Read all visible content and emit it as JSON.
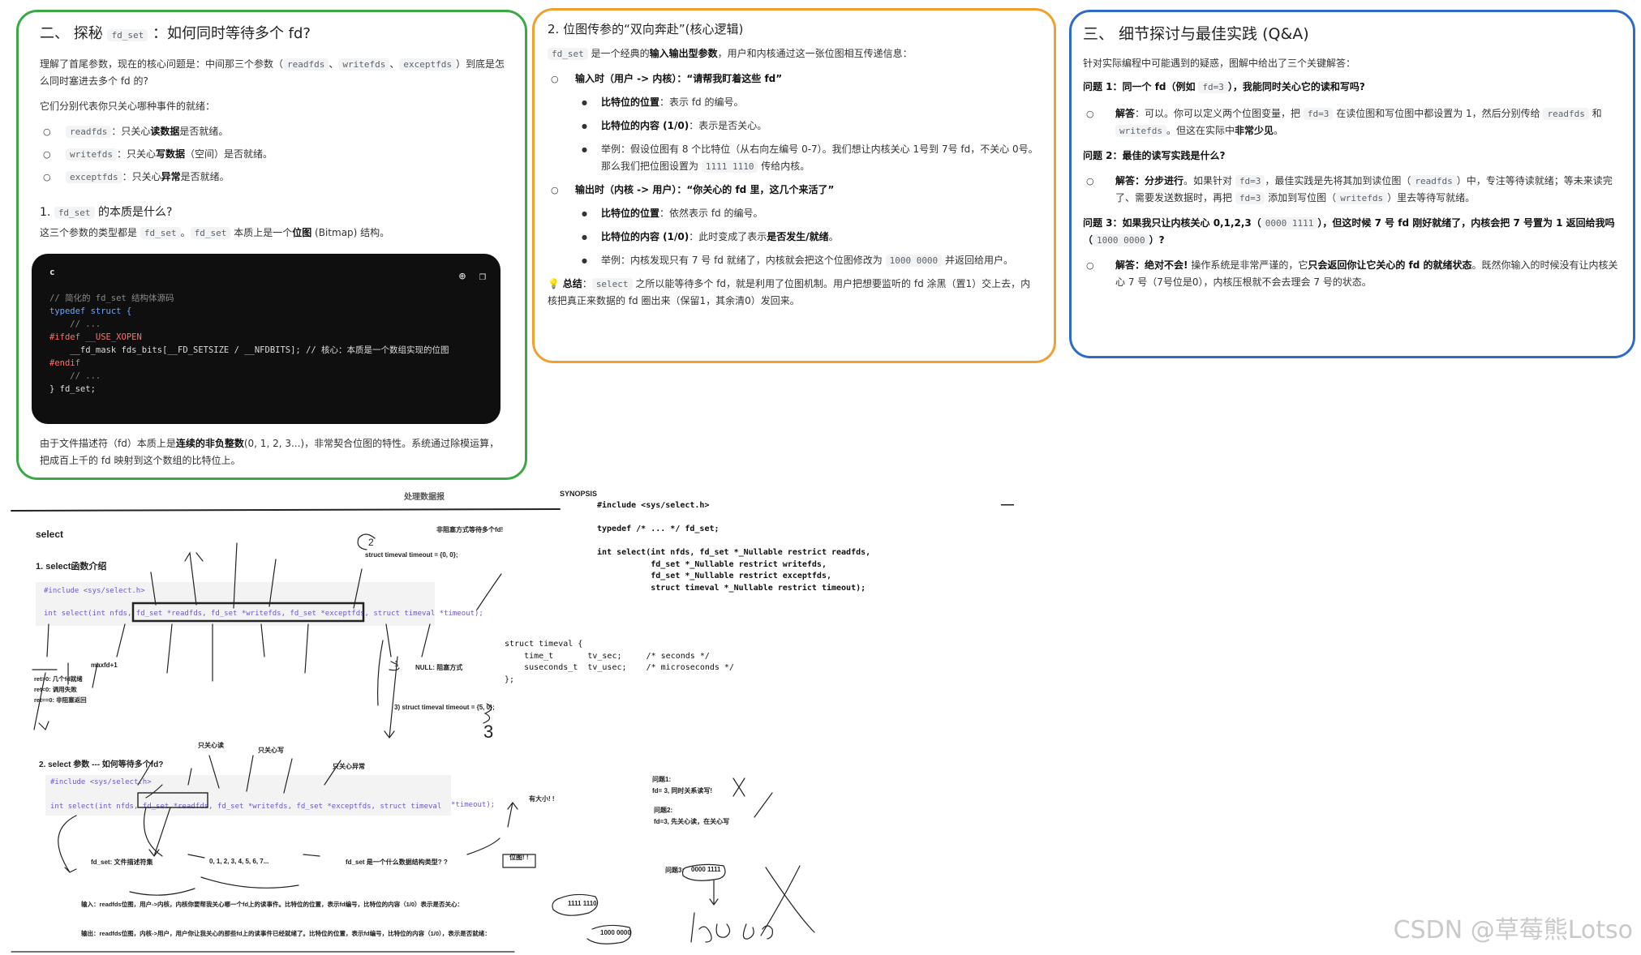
{
  "green": {
    "title_pre": "二、 探秘",
    "title_code": "fd_set",
    "title_post": "：如何同时等待多个 fd?",
    "intro_1": "理解了首尾参数，现在的核心问题是：中间那三个参数（",
    "intro_c1": "readfds",
    "intro_c2": "writefds",
    "intro_c3": "exceptfds",
    "intro_2": "）到底是怎么同时塞进去多个 fd 的?",
    "intro_3": "它们分别代表你只关心哪种事件的就绪：",
    "items": [
      {
        "code": "readfds",
        "pre": "：只关心",
        "bold": "读数据",
        "post": "是否就绪。"
      },
      {
        "code": "writefds",
        "pre": "：只关心",
        "bold": "写数据",
        "post": "（空间）是否就绪。"
      },
      {
        "code": "exceptfds",
        "pre": "：只关心",
        "bold": "异常",
        "post": "是否就绪。"
      }
    ],
    "sub_pre": "1.",
    "sub_code": "fd_set",
    "sub_post": "的本质是什么?",
    "sub_text_1": "这三个参数的类型都是",
    "sub_text_c1": "fd_set",
    "sub_text_c2": "fd_set",
    "sub_text_2": "本质上是一个",
    "sub_text_bold": "位图",
    "sub_text_3": "(Bitmap) 结构。",
    "code_lang": "c",
    "code_lines": [
      "// 简化的 fd_set 结构体源码",
      "typedef struct {",
      "    // ...",
      "#ifdef __USE_XOPEN",
      "    __fd_mask fds_bits[__FD_SETSIZE / __NFDBITS]; // 核心：本质是一个数组实现的位图",
      "#endif",
      "    // ...",
      "} fd_set;"
    ],
    "outro_1": "由于文件描述符（fd）本质上是",
    "outro_bold": "连续的非负整数",
    "outro_2": "(0, 1, 2, 3...)，非常契合位图的特性。系统通过除模运算，把成百上千的 fd 映射到这个数组的比特位上。"
  },
  "orange": {
    "title": "2. 位图传参的“双向奔赴”(核心逻辑)",
    "intro_code": "fd_set",
    "intro_1": "是一个经典的",
    "intro_bold": "输入输出型参数",
    "intro_2": "，用户和内核通过这一张位图相互传递信息：",
    "in_title": "输入时（用户 -> 内核）：“请帮我盯着这些 fd”",
    "in_pos_bold": "比特位的位置",
    "in_pos": "：表示 fd 的编号。",
    "in_val_bold": "比特位的内容 (1/0)",
    "in_val": "：表示是否关心。",
    "in_ex_1": "举例：假设位图有 8 个比特位（从右向左编号 0-7）。我们想让内核关心 1号到 7号 fd，不关心 0号。那么我们把位图设置为",
    "in_ex_code": "1111 1110",
    "in_ex_2": "传给内核。",
    "out_title": "输出时（内核 -> 用户）：“你关心的 fd 里，这几个来活了”",
    "out_pos_bold": "比特位的位置",
    "out_pos": "：依然表示 fd 的编号。",
    "out_val_bold": "比特位的内容 (1/0)",
    "out_val": "：此时变成了表示",
    "out_val_bold2": "是否发生/就绪",
    "out_val_end": "。",
    "out_ex_1": "举例：内核发现只有 7 号 fd 就绪了，内核就会把这个位图修改为",
    "out_ex_code": "1000 0000",
    "out_ex_2": "并返回给用户。",
    "sum_icon": "💡",
    "sum_bold": "总结",
    "sum_code": "select",
    "sum_text": "之所以能等待多个 fd，就是利用了位图机制。用户把想要监听的 fd 涂黑（置1）交上去，内核把真正来数据的 fd 圈出来（保留1，其余清0）发回来。"
  },
  "blue": {
    "title": "三、 细节探讨与最佳实践 (Q&A)",
    "intro": "针对实际编程中可能遇到的疑惑，图解中给出了三个关键解答：",
    "q1_a": "问题 1：同一个 fd（例如",
    "q1_code": "fd=3",
    "q1_b": "），我能同时关心它的读和写吗?",
    "a1_bold": "解答",
    "a1_1": "：可以。你可以定义两个位图变量，把",
    "a1_code": "fd=3",
    "a1_2": "在读位图和写位图中都设置为 1，然后分别传给",
    "a1_c2": "readfds",
    "a1_3": "和",
    "a1_c3": "writefds",
    "a1_4": "。但这在实际中",
    "a1_bold2": "非常少见",
    "a1_5": "。",
    "q2": "问题 2：最佳的读写实践是什么?",
    "a2_bold": "解答：分步进行",
    "a2_1": "。如果针对",
    "a2_code": "fd=3",
    "a2_2": "，最佳实践是先将其加到读位图（",
    "a2_c2": "readfds",
    "a2_3": "）中，专注等待读就绪；等未来读完了、需要发送数据时，再把",
    "a2_c3": "fd=3",
    "a2_4": "添加到写位图（",
    "a2_c4": "writefds",
    "a2_5": "）里去等待写就绪。",
    "q3_a": "问题 3：如果我只让内核关心 0,1,2,3（",
    "q3_code": "0000 1111",
    "q3_b": "），但这时候 7 号 fd 刚好就绪了，内核会把 7 号置为 1 返回给我吗（",
    "q3_code2": "1000 0000",
    "q3_c": "）?",
    "a3_bold": "解答：绝对不会!",
    "a3_1": "操作系统是非常严谨的，它",
    "a3_bold2": "只会返回你让它关心的 fd 的就绪状态",
    "a3_2": "。既然你输入的时候没有让内核关心 7 号（7号位是0），内核压根就不会去理会 7 号的状态。"
  },
  "notes": {
    "top_cut": "处理数据报",
    "select_title": "select",
    "sec1": "1. select函数介绍",
    "inc1": "#include <sys/select.h>",
    "sig1": "int select(int nfds, fd_set *readfds, fd_set *writefds, fd_set *exceptfds, struct timeval *timeout);",
    "nonblock": "非阻塞方式等待多个fd!",
    "num2": "2",
    "tv0": "struct timeval timeout = {0,  0};",
    "maxfd": "maxfd+1",
    "ret1": "ret>0: 几个fd就绪",
    "ret2": "ret<0: 调用失败",
    "ret3": "ret==0: 非阻塞返回",
    "num1": "1",
    "nullblock": "NULL: 阻塞方式",
    "tv5": "3)  struct timeval timeout = {5,  0};",
    "num3": "3",
    "sec2": "2. select 参数 --- 如何等待多个fd?",
    "only_read": "只关心读",
    "only_write": "只关心写",
    "only_except": "只关心异常",
    "inc2": "#include <sys/select.h>",
    "sig2": "int select(int nfds, fd_set *readfds, fd_set *writefds, fd_set *exceptfds, struct timeval",
    "sig2_end": "*timeout);",
    "have_size": "有大小! !",
    "fdset_desc": "fd_set: 文件描述符集",
    "seq": "0, 1, 2,  3,  4,  5,  6,  7...",
    "fdset_q": "fd_set 是一个什么数据结构类型? ?",
    "bitmap": "位图! !",
    "input_line": "输入：readfds位图，用户->内核，内核你要帮我关心哪一个fd上的读事件。比特位的位置，表示fd编号，比特位的内容（1/0）表示是否关心：",
    "input_val": "1111 1110",
    "output_line": "输出：readfds位图，内核->用户，用户你让我关心的那些fd上的读事件已经就绪了。比特位的位置，表示fd编号，比特位的内容（1/0），表示是否就绪：",
    "output_val": "1000 0000",
    "q1": "问题1:",
    "q1b": "fd= 3,   同时关系读写!",
    "q2": "问题2:",
    "q2b": "fd=3,  先关心读，在关心写",
    "q3": "问题3:",
    "q3v": "0000 1111",
    "synopsis": "SYNOPSIS",
    "syn_lines": [
      "#include <sys/select.h>",
      "",
      "typedef /* ... */ fd_set;",
      "",
      "int select(int nfds, fd_set *_Nullable restrict readfds,",
      "           fd_set *_Nullable restrict writefds,",
      "           fd_set *_Nullable restrict exceptfds,",
      "           struct timeval *_Nullable restrict timeout);"
    ],
    "tv_lines": [
      "struct timeval {",
      "    time_t       tv_sec;     /* seconds */",
      "    suseconds_t  tv_usec;    /* microseconds */",
      "};"
    ],
    "dash": "—"
  },
  "watermark": "CSDN @草莓熊Lotso"
}
